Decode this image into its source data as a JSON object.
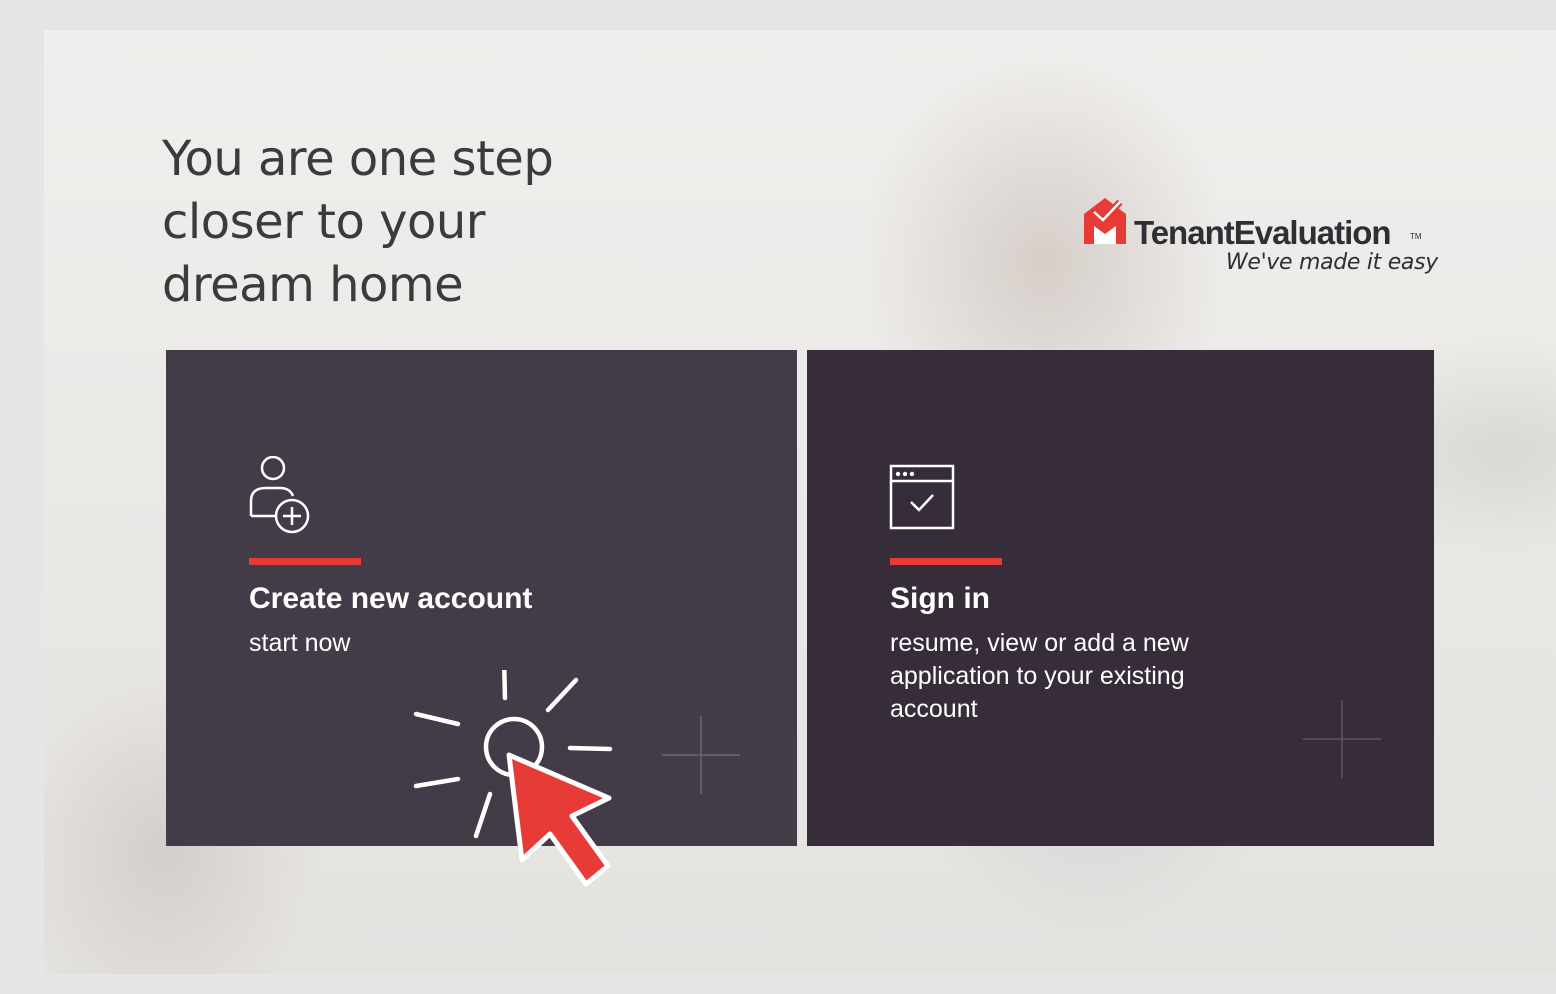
{
  "hero": {
    "headline": "You are one step closer to your dream home"
  },
  "brand": {
    "name": "TenantEvaluation",
    "trademark": "TM",
    "tagline": "We've made it easy",
    "accent_color": "#e63b36"
  },
  "cards": {
    "create": {
      "icon": "add-user-icon",
      "title": "Create new account",
      "subtitle": "start now",
      "background": "#433b47"
    },
    "signin": {
      "icon": "browser-check-icon",
      "title": "Sign in",
      "subtitle": "resume, view or add a new application to your existing account",
      "background": "#362c3a"
    }
  },
  "annotation": {
    "icon": "click-cursor-icon",
    "color": "#e63b36"
  }
}
